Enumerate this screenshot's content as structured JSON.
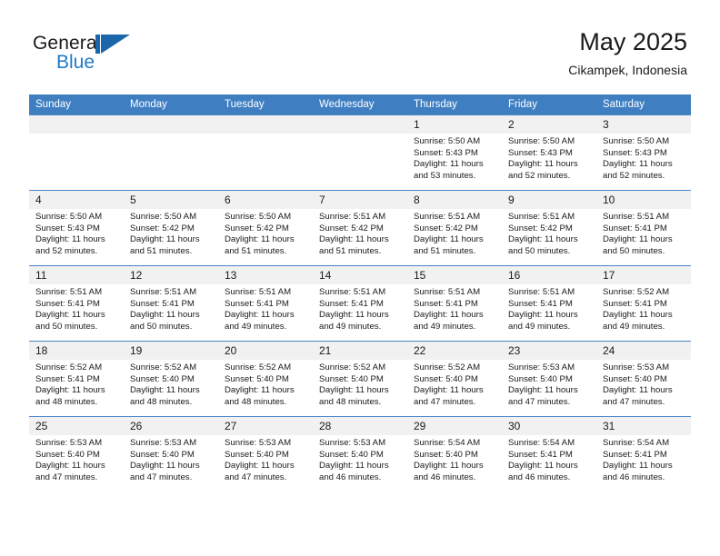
{
  "logo": {
    "word_one": "General",
    "word_two": "Blue",
    "mark_name": "blue-triangle-mark"
  },
  "header": {
    "title": "May 2025",
    "subtitle": "Cikampek, Indonesia"
  },
  "colors": {
    "header_blue": "#3f7fc1",
    "row_rule_blue": "#4a86c5",
    "daynum_band": "#f1f1f1",
    "logo_blue": "#1f7ac4",
    "text": "#1a1a1a"
  },
  "weekday_headers": [
    "Sunday",
    "Monday",
    "Tuesday",
    "Wednesday",
    "Thursday",
    "Friday",
    "Saturday"
  ],
  "labels": {
    "sunrise_prefix": "Sunrise:",
    "sunset_prefix": "Sunset:",
    "daylight_prefix": "Daylight:"
  },
  "weeks": [
    [
      {
        "day": "",
        "empty": true,
        "line1": "",
        "line2": "",
        "line3": "",
        "line4": ""
      },
      {
        "day": "",
        "empty": true,
        "line1": "",
        "line2": "",
        "line3": "",
        "line4": ""
      },
      {
        "day": "",
        "empty": true,
        "line1": "",
        "line2": "",
        "line3": "",
        "line4": ""
      },
      {
        "day": "",
        "empty": true,
        "line1": "",
        "line2": "",
        "line3": "",
        "line4": ""
      },
      {
        "day": "1",
        "empty": false,
        "line1": "Sunrise: 5:50 AM",
        "line2": "Sunset: 5:43 PM",
        "line3": "Daylight: 11 hours",
        "line4": "and 53 minutes."
      },
      {
        "day": "2",
        "empty": false,
        "line1": "Sunrise: 5:50 AM",
        "line2": "Sunset: 5:43 PM",
        "line3": "Daylight: 11 hours",
        "line4": "and 52 minutes."
      },
      {
        "day": "3",
        "empty": false,
        "line1": "Sunrise: 5:50 AM",
        "line2": "Sunset: 5:43 PM",
        "line3": "Daylight: 11 hours",
        "line4": "and 52 minutes."
      }
    ],
    [
      {
        "day": "4",
        "empty": false,
        "line1": "Sunrise: 5:50 AM",
        "line2": "Sunset: 5:43 PM",
        "line3": "Daylight: 11 hours",
        "line4": "and 52 minutes."
      },
      {
        "day": "5",
        "empty": false,
        "line1": "Sunrise: 5:50 AM",
        "line2": "Sunset: 5:42 PM",
        "line3": "Daylight: 11 hours",
        "line4": "and 51 minutes."
      },
      {
        "day": "6",
        "empty": false,
        "line1": "Sunrise: 5:50 AM",
        "line2": "Sunset: 5:42 PM",
        "line3": "Daylight: 11 hours",
        "line4": "and 51 minutes."
      },
      {
        "day": "7",
        "empty": false,
        "line1": "Sunrise: 5:51 AM",
        "line2": "Sunset: 5:42 PM",
        "line3": "Daylight: 11 hours",
        "line4": "and 51 minutes."
      },
      {
        "day": "8",
        "empty": false,
        "line1": "Sunrise: 5:51 AM",
        "line2": "Sunset: 5:42 PM",
        "line3": "Daylight: 11 hours",
        "line4": "and 51 minutes."
      },
      {
        "day": "9",
        "empty": false,
        "line1": "Sunrise: 5:51 AM",
        "line2": "Sunset: 5:42 PM",
        "line3": "Daylight: 11 hours",
        "line4": "and 50 minutes."
      },
      {
        "day": "10",
        "empty": false,
        "line1": "Sunrise: 5:51 AM",
        "line2": "Sunset: 5:41 PM",
        "line3": "Daylight: 11 hours",
        "line4": "and 50 minutes."
      }
    ],
    [
      {
        "day": "11",
        "empty": false,
        "line1": "Sunrise: 5:51 AM",
        "line2": "Sunset: 5:41 PM",
        "line3": "Daylight: 11 hours",
        "line4": "and 50 minutes."
      },
      {
        "day": "12",
        "empty": false,
        "line1": "Sunrise: 5:51 AM",
        "line2": "Sunset: 5:41 PM",
        "line3": "Daylight: 11 hours",
        "line4": "and 50 minutes."
      },
      {
        "day": "13",
        "empty": false,
        "line1": "Sunrise: 5:51 AM",
        "line2": "Sunset: 5:41 PM",
        "line3": "Daylight: 11 hours",
        "line4": "and 49 minutes."
      },
      {
        "day": "14",
        "empty": false,
        "line1": "Sunrise: 5:51 AM",
        "line2": "Sunset: 5:41 PM",
        "line3": "Daylight: 11 hours",
        "line4": "and 49 minutes."
      },
      {
        "day": "15",
        "empty": false,
        "line1": "Sunrise: 5:51 AM",
        "line2": "Sunset: 5:41 PM",
        "line3": "Daylight: 11 hours",
        "line4": "and 49 minutes."
      },
      {
        "day": "16",
        "empty": false,
        "line1": "Sunrise: 5:51 AM",
        "line2": "Sunset: 5:41 PM",
        "line3": "Daylight: 11 hours",
        "line4": "and 49 minutes."
      },
      {
        "day": "17",
        "empty": false,
        "line1": "Sunrise: 5:52 AM",
        "line2": "Sunset: 5:41 PM",
        "line3": "Daylight: 11 hours",
        "line4": "and 49 minutes."
      }
    ],
    [
      {
        "day": "18",
        "empty": false,
        "line1": "Sunrise: 5:52 AM",
        "line2": "Sunset: 5:41 PM",
        "line3": "Daylight: 11 hours",
        "line4": "and 48 minutes."
      },
      {
        "day": "19",
        "empty": false,
        "line1": "Sunrise: 5:52 AM",
        "line2": "Sunset: 5:40 PM",
        "line3": "Daylight: 11 hours",
        "line4": "and 48 minutes."
      },
      {
        "day": "20",
        "empty": false,
        "line1": "Sunrise: 5:52 AM",
        "line2": "Sunset: 5:40 PM",
        "line3": "Daylight: 11 hours",
        "line4": "and 48 minutes."
      },
      {
        "day": "21",
        "empty": false,
        "line1": "Sunrise: 5:52 AM",
        "line2": "Sunset: 5:40 PM",
        "line3": "Daylight: 11 hours",
        "line4": "and 48 minutes."
      },
      {
        "day": "22",
        "empty": false,
        "line1": "Sunrise: 5:52 AM",
        "line2": "Sunset: 5:40 PM",
        "line3": "Daylight: 11 hours",
        "line4": "and 47 minutes."
      },
      {
        "day": "23",
        "empty": false,
        "line1": "Sunrise: 5:53 AM",
        "line2": "Sunset: 5:40 PM",
        "line3": "Daylight: 11 hours",
        "line4": "and 47 minutes."
      },
      {
        "day": "24",
        "empty": false,
        "line1": "Sunrise: 5:53 AM",
        "line2": "Sunset: 5:40 PM",
        "line3": "Daylight: 11 hours",
        "line4": "and 47 minutes."
      }
    ],
    [
      {
        "day": "25",
        "empty": false,
        "line1": "Sunrise: 5:53 AM",
        "line2": "Sunset: 5:40 PM",
        "line3": "Daylight: 11 hours",
        "line4": "and 47 minutes."
      },
      {
        "day": "26",
        "empty": false,
        "line1": "Sunrise: 5:53 AM",
        "line2": "Sunset: 5:40 PM",
        "line3": "Daylight: 11 hours",
        "line4": "and 47 minutes."
      },
      {
        "day": "27",
        "empty": false,
        "line1": "Sunrise: 5:53 AM",
        "line2": "Sunset: 5:40 PM",
        "line3": "Daylight: 11 hours",
        "line4": "and 47 minutes."
      },
      {
        "day": "28",
        "empty": false,
        "line1": "Sunrise: 5:53 AM",
        "line2": "Sunset: 5:40 PM",
        "line3": "Daylight: 11 hours",
        "line4": "and 46 minutes."
      },
      {
        "day": "29",
        "empty": false,
        "line1": "Sunrise: 5:54 AM",
        "line2": "Sunset: 5:40 PM",
        "line3": "Daylight: 11 hours",
        "line4": "and 46 minutes."
      },
      {
        "day": "30",
        "empty": false,
        "line1": "Sunrise: 5:54 AM",
        "line2": "Sunset: 5:41 PM",
        "line3": "Daylight: 11 hours",
        "line4": "and 46 minutes."
      },
      {
        "day": "31",
        "empty": false,
        "line1": "Sunrise: 5:54 AM",
        "line2": "Sunset: 5:41 PM",
        "line3": "Daylight: 11 hours",
        "line4": "and 46 minutes."
      }
    ]
  ]
}
